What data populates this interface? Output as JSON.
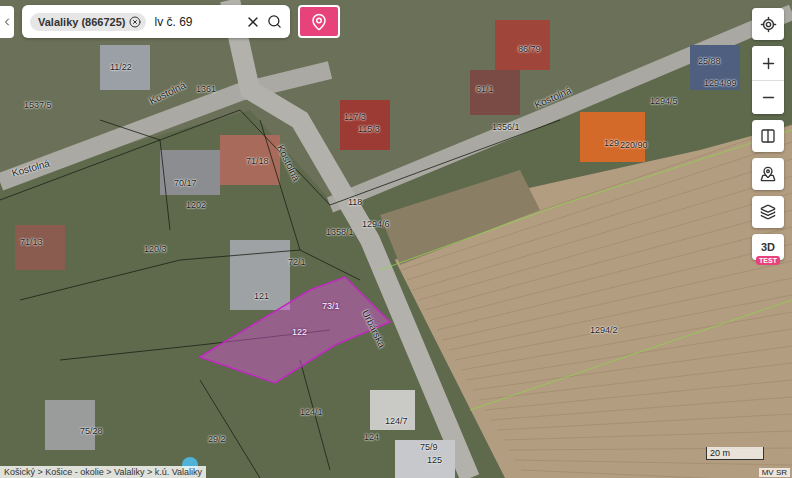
{
  "search": {
    "chip": "Valaliky (866725)",
    "query": "lv č. 69"
  },
  "view_toggle": {
    "label": "3D",
    "badge": "TEST"
  },
  "map": {
    "streets": [
      {
        "name": "Kostolná"
      },
      {
        "name": "Kostolná"
      },
      {
        "name": "Kostolná"
      },
      {
        "name": "Kostolná"
      },
      {
        "name": "Urbárska"
      }
    ],
    "parcels": [
      {
        "number": "1361",
        "selected": false
      },
      {
        "number": "11/22",
        "selected": false
      },
      {
        "number": "1537/5",
        "selected": false
      },
      {
        "number": "117/3",
        "selected": false
      },
      {
        "number": "115/3",
        "selected": false
      },
      {
        "number": "61/1",
        "selected": false
      },
      {
        "number": "86/79",
        "selected": false
      },
      {
        "number": "129",
        "selected": false
      },
      {
        "number": "220/90",
        "selected": false
      },
      {
        "number": "25/88",
        "selected": false
      },
      {
        "number": "1294/99",
        "selected": false
      },
      {
        "number": "1294/5",
        "selected": false
      },
      {
        "number": "1356/1",
        "selected": false
      },
      {
        "number": "71/18",
        "selected": false
      },
      {
        "number": "70/17",
        "selected": false
      },
      {
        "number": "1202",
        "selected": false
      },
      {
        "number": "71/13",
        "selected": false
      },
      {
        "number": "120/3",
        "selected": false
      },
      {
        "number": "1358/1",
        "selected": false
      },
      {
        "number": "1294/6",
        "selected": false
      },
      {
        "number": "118",
        "selected": false
      },
      {
        "number": "72/1",
        "selected": false
      },
      {
        "number": "121",
        "selected": false
      },
      {
        "number": "73/1",
        "selected": true
      },
      {
        "number": "122",
        "selected": true
      },
      {
        "number": "1294/2",
        "selected": false
      },
      {
        "number": "124/1",
        "selected": false
      },
      {
        "number": "124/7",
        "selected": false
      },
      {
        "number": "124",
        "selected": false
      },
      {
        "number": "125",
        "selected": false
      },
      {
        "number": "75/28",
        "selected": false
      },
      {
        "number": "29/2",
        "selected": false
      },
      {
        "number": "75/9",
        "selected": false
      }
    ]
  },
  "breadcrumb": "Košický > Košice - okolie > Valaliky > k.ú. Valaliky",
  "scale": "20 m",
  "attribution": "MV SR"
}
